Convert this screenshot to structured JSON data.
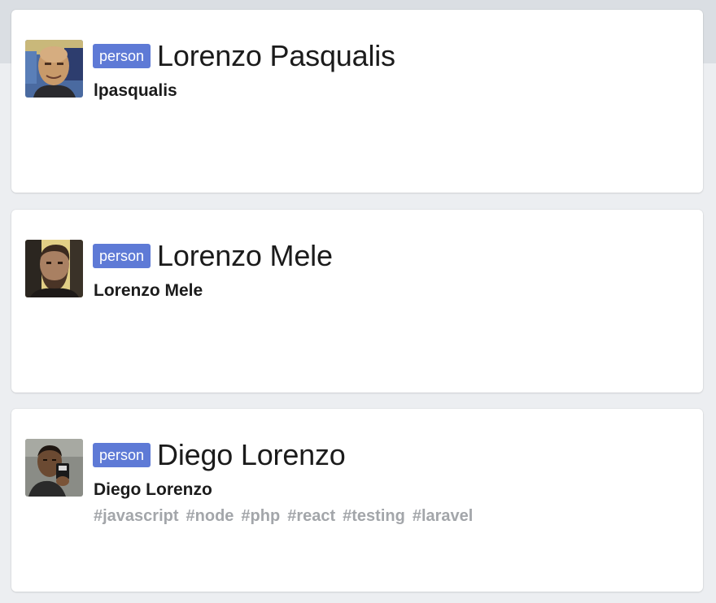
{
  "colors": {
    "badge_bg": "#5e7ad6",
    "badge_text": "#ffffff",
    "name_text": "#1b1b1b",
    "tag_text": "#a3a6aa",
    "card_bg": "#ffffff",
    "page_bg": "#eceef1"
  },
  "results": [
    {
      "badge": "person",
      "name": "Lorenzo Pasqualis",
      "username": "lpasqualis",
      "avatar": "person-photo-bald",
      "tags": []
    },
    {
      "badge": "person",
      "name": "Lorenzo Mele",
      "username": "Lorenzo Mele",
      "avatar": "person-photo-bearded",
      "tags": []
    },
    {
      "badge": "person",
      "name": "Diego Lorenzo",
      "username": "Diego Lorenzo",
      "avatar": "person-photo-drinking",
      "tags": [
        "#javascript",
        "#node",
        "#php",
        "#react",
        "#testing",
        "#laravel"
      ]
    }
  ]
}
